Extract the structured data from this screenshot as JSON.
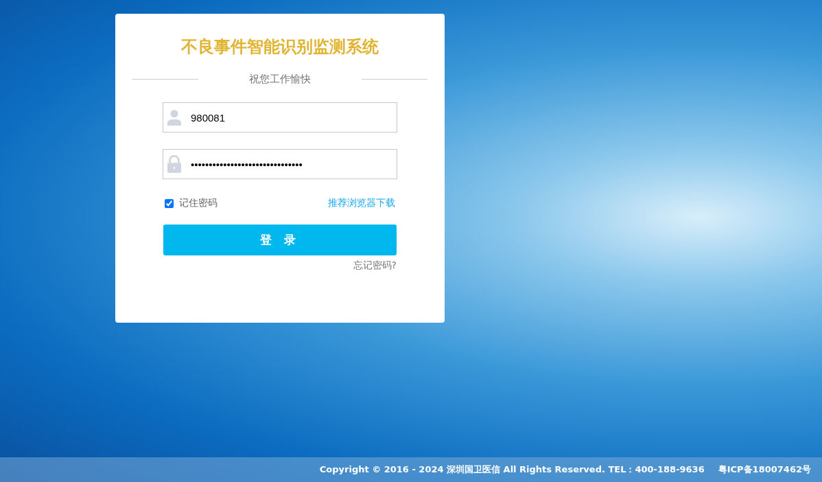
{
  "login_card": {
    "title": "不良事件智能识别监测系统",
    "subtitle": "祝您工作愉快",
    "username": {
      "value": "980081"
    },
    "password": {
      "value": "•••••••••••••••••••••••••••••••"
    },
    "remember": {
      "label": "记住密码",
      "checked": true
    },
    "browser_link": "推荐浏览器下载",
    "login_button": "登 录",
    "forgot_link": "忘记密码?"
  },
  "footer": {
    "copyright": "Copyright © 2016 - 2024 深圳国卫医信 All Rights Reserved. TEL：400-188-9636",
    "icp": "粤ICP备18007462号"
  }
}
